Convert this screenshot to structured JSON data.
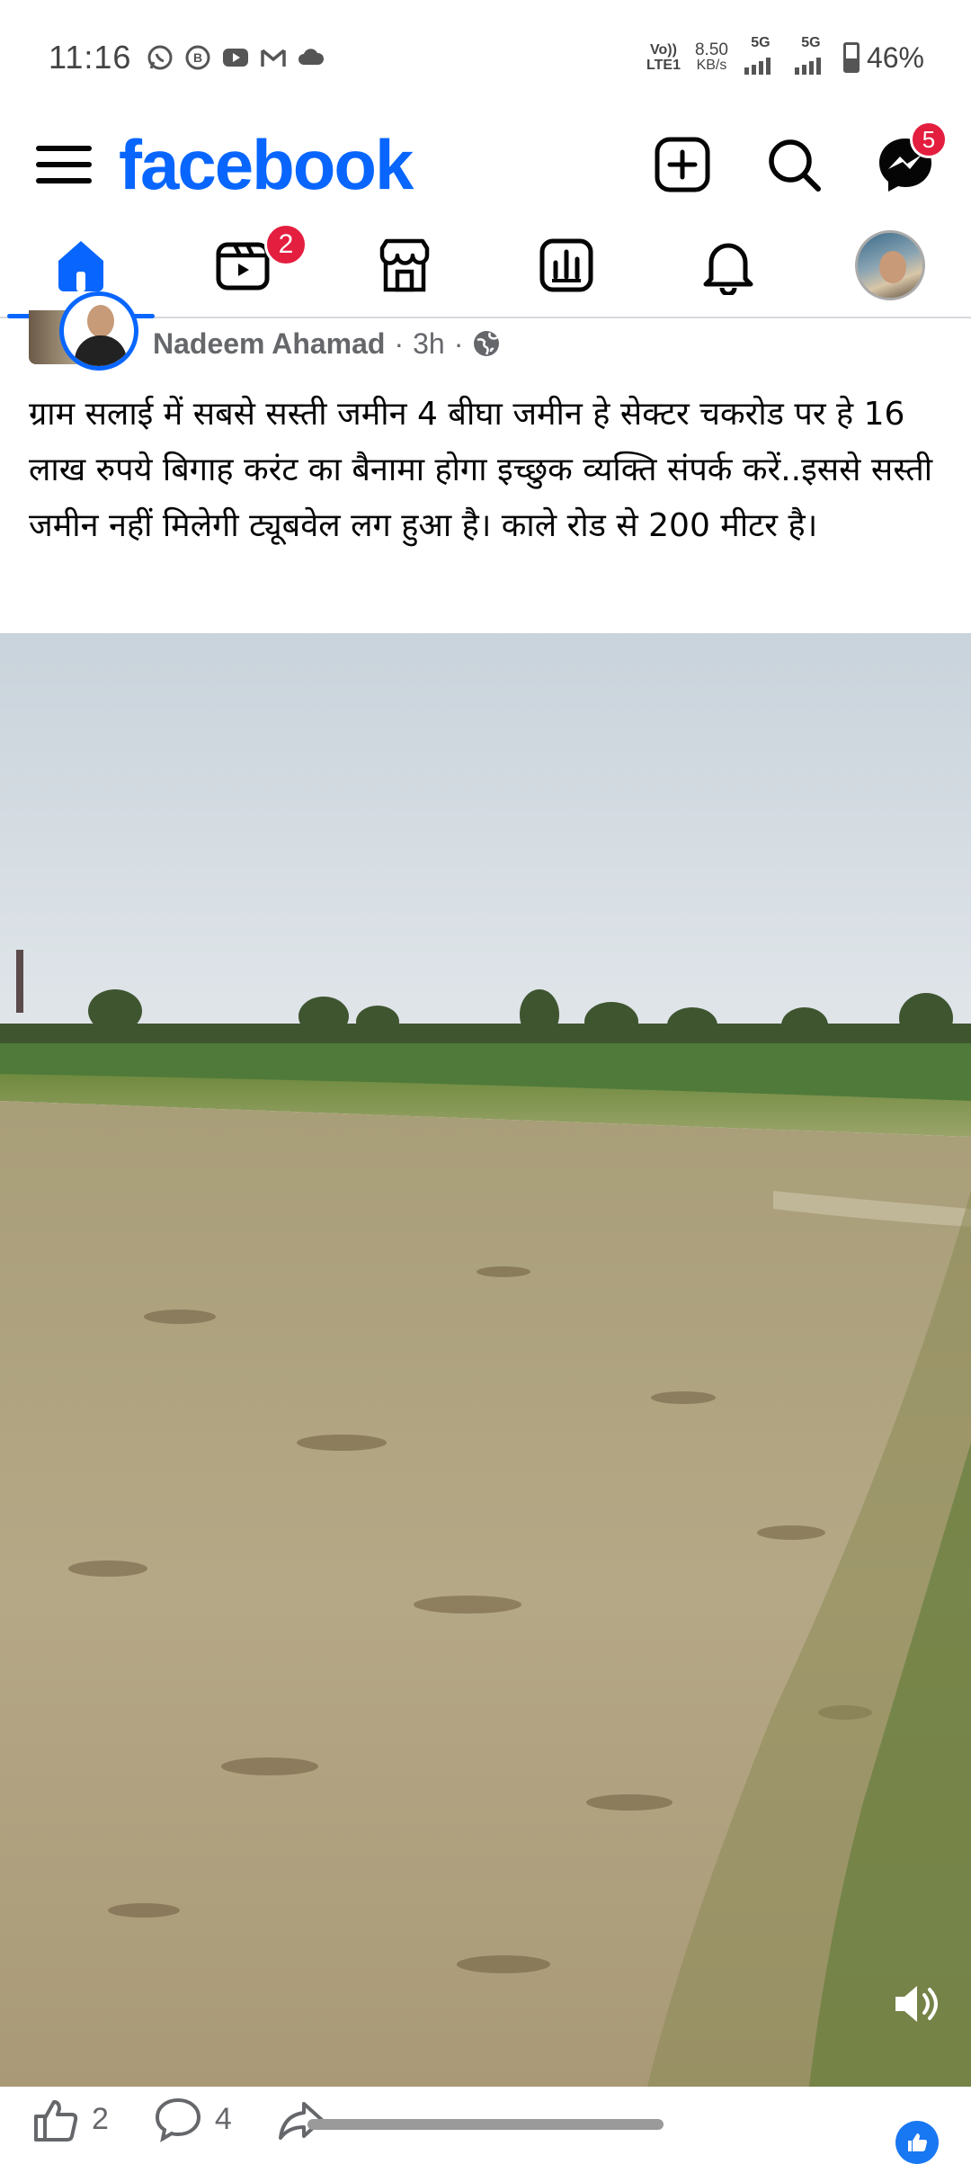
{
  "status_bar": {
    "time": "11:16",
    "network_top": "Vo))",
    "network_bottom": "LTE1",
    "speed_value": "8.50",
    "speed_unit": "KB/s",
    "net1": "5G",
    "net2": "5G",
    "battery": "46%",
    "battery_level": 0.46,
    "notification_icons": [
      "whatsapp-icon",
      "whatsapp-business-icon",
      "youtube-icon",
      "gmail-icon",
      "cloud-icon"
    ]
  },
  "header": {
    "logo": "facebook",
    "messenger_badge": "5",
    "brand_color": "#0866ff",
    "badge_color": "#e41e3f"
  },
  "tabs": [
    {
      "name": "home",
      "icon": "home-icon",
      "active": true
    },
    {
      "name": "video",
      "icon": "video-icon",
      "badge": "2"
    },
    {
      "name": "marketplace",
      "icon": "marketplace-icon"
    },
    {
      "name": "dashboard",
      "icon": "dashboard-icon"
    },
    {
      "name": "notifications",
      "icon": "bell-icon"
    },
    {
      "name": "profile",
      "icon": "profile-avatar"
    }
  ],
  "post": {
    "author": "Nadeem Ahamad",
    "time": "3h",
    "separator": "·",
    "privacy_icon": "globe-icon",
    "text": "ग्राम सलाई में सबसे सस्ती जमीन 4 बीघा जमीन हे सेक्टर चकरोड पर हे 16 लाख रुपये बिगाह करंट का बैनामा होगा इच्छुक व्यक्ति संपर्क करें..इससे सस्ती जमीन नहीं मिलेगी ट्यूबवेल लग हुआ है। काले रोड से 200 मीटर है।",
    "media": "video"
  },
  "actions": {
    "like_count": "2",
    "comment_count": "4"
  }
}
